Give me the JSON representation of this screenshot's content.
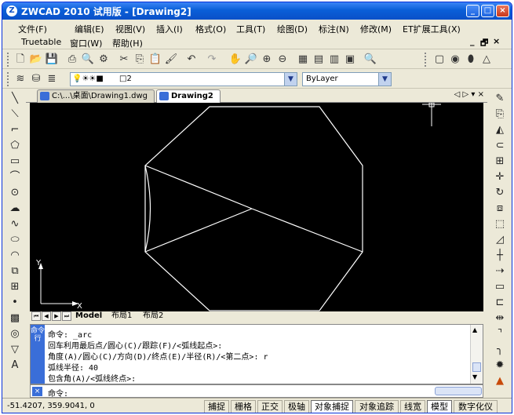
{
  "window": {
    "title": "ZWCAD 2010 试用版 - [Drawing2]",
    "app_icon": "Z",
    "controls": [
      "_",
      "□",
      "×"
    ]
  },
  "menu": {
    "items": [
      "文件(F)",
      "编辑(E)",
      "视图(V)",
      "插入(I)",
      "格式(O)",
      "工具(T)",
      "绘图(D)",
      "标注(N)",
      "修改(M)",
      "ET扩展工具(X)"
    ],
    "items_row2": [
      "Truetable",
      "窗口(W)",
      "帮助(H)"
    ],
    "mdi_controls": [
      "_",
      "🗗",
      "×"
    ]
  },
  "layer_bar": {
    "layer_value": "□2",
    "linetype_value": "ByLayer"
  },
  "doc_tabs": {
    "tab1": "C:\\...\\桌面\\Drawing1.dwg",
    "tab2": "Drawing2",
    "nav": "◁ ▷ ▾ ×"
  },
  "canvas": {
    "ucs_y": "Y",
    "ucs_x": "X"
  },
  "layout_tabs": {
    "model": "Model",
    "layout1": "布局1",
    "layout2": "布局2"
  },
  "command": {
    "side_label": "命令行",
    "lines": [
      "命令: _arc",
      "回车利用最后点/圆心(C)/跟踪(F)/<弧线起点>:",
      "角度(A)/圆心(C)/方向(D)/终点(E)/半径(R)/<第二点>: r",
      "弧线半径: 40",
      "包含角(A)/<弧线终点>:"
    ],
    "prompt": "命令:"
  },
  "status": {
    "coords": "-51.4207,  359.9041,  0",
    "buttons": [
      {
        "label": "捕捉",
        "on": false
      },
      {
        "label": "栅格",
        "on": false
      },
      {
        "label": "正交",
        "on": false
      },
      {
        "label": "极轴",
        "on": false
      },
      {
        "label": "对象捕捉",
        "on": true
      },
      {
        "label": "对象追踪",
        "on": false
      },
      {
        "label": "线宽",
        "on": false
      },
      {
        "label": "模型",
        "on": true
      },
      {
        "label": "数字化仪",
        "on": false
      }
    ]
  },
  "colors": {
    "titlebar": "#0a5fd8",
    "canvas": "#000000",
    "drawing": "#ffffff",
    "command_side": "#3a6ed8"
  }
}
